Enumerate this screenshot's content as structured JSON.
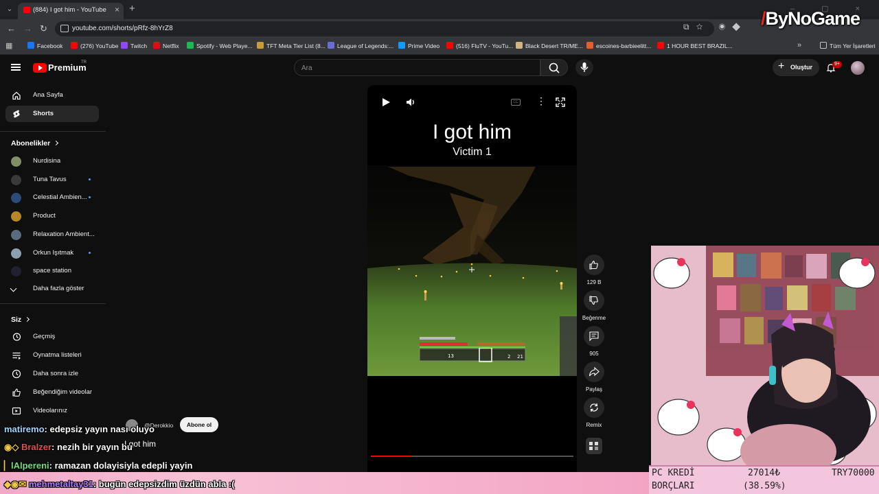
{
  "browser": {
    "tab_title": "(884) I got him - YouTube",
    "url": "youtube.com/shorts/pRfz-8hYrZ8",
    "bookmarks": [
      {
        "label": "Facebook",
        "color": "#1877f2"
      },
      {
        "label": "(276) YouTube",
        "color": "#ff0000"
      },
      {
        "label": "Twitch",
        "color": "#9146ff"
      },
      {
        "label": "Netflix",
        "color": "#e50914"
      },
      {
        "label": "Spotify - Web Playe...",
        "color": "#1db954"
      },
      {
        "label": "TFT Meta Tier List (8...",
        "color": "#c89b3c"
      },
      {
        "label": "League of Legends:...",
        "color": "#6b6bd6"
      },
      {
        "label": "Prime Video",
        "color": "#1399ff"
      },
      {
        "label": "(516) FluTV - YouTu...",
        "color": "#ff0000"
      },
      {
        "label": "Black Desert TR/ME...",
        "color": "#d4b483"
      },
      {
        "label": "escoines-barbieelitt...",
        "color": "#e06030"
      },
      {
        "label": "1 HOUR BEST BRAZIL...",
        "color": "#ff0000"
      }
    ],
    "all_bookmarks": "Tüm Yer İşaretleri"
  },
  "watermark": {
    "brand": "ByNoGame"
  },
  "youtube": {
    "logo": "Premium",
    "region": "TR",
    "search_placeholder": "Ara",
    "create_label": "Oluştur",
    "notif_badge": "9+"
  },
  "sidebar": {
    "home": "Ana Sayfa",
    "shorts": "Shorts",
    "subscriptions_header": "Abonelikler",
    "subscriptions": [
      {
        "name": "Nurdisina",
        "color": "#7e8f6a",
        "dot": false
      },
      {
        "name": "Tuna Tavus",
        "color": "#3a3a3a",
        "dot": true
      },
      {
        "name": "Celestial Ambien...",
        "color": "#2c4b7a",
        "dot": true
      },
      {
        "name": "Product",
        "color": "#b8862a",
        "dot": false
      },
      {
        "name": "Relaxation Ambient...",
        "color": "#5a6b80",
        "dot": false
      },
      {
        "name": "Orkun Işıtmak",
        "color": "#8aa0b0",
        "dot": true
      },
      {
        "name": "space station",
        "color": "#202030",
        "dot": false
      }
    ],
    "show_more": "Daha fazla göster",
    "you_header": "Siz",
    "you_items": [
      "Geçmiş",
      "Oynatma listeleri",
      "Daha sonra izle",
      "Beğendiğim videolar",
      "Videolarınız"
    ]
  },
  "short": {
    "overlay_title": "I got him",
    "overlay_subtitle": "Victim 1",
    "channel": "@Derokkio",
    "subscribe": "Abone ol",
    "caption": "I got him",
    "progress": 0.2,
    "hotbar_counts": [
      "13",
      "2",
      "21"
    ]
  },
  "actions": {
    "likes": "129 B",
    "dislike": "Beğenme",
    "comments": "905",
    "share": "Paylaş",
    "remix": "Remix"
  },
  "chat": [
    {
      "user": "matiremo",
      "text": ": edepsiz yayın nası oluyo",
      "user_color": "#9fd7ff"
    },
    {
      "user": "Bralzer",
      "text": ": nezih bir yayın bu",
      "user_color": "#e84d4d"
    },
    {
      "user": "lAlpereni",
      "text": ": ramazan dolayisiyla edepli yayin",
      "user_color": "#6fe07a"
    },
    {
      "user": "mehmetaltay31",
      "text": ": bugün edepsizdim üzdün abla :(",
      "user_color": "#b57bff"
    }
  ],
  "ticker": {
    "line1": "PC KREDİ",
    "line2": "BORÇLARI",
    "value1": "27014₺",
    "value2": "(38.59%)",
    "code": "TRY70000"
  }
}
